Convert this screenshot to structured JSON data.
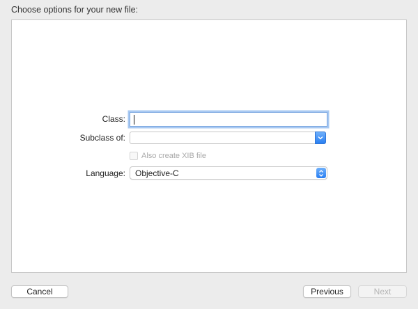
{
  "window": {
    "heading": "Choose options for your new file:"
  },
  "form": {
    "class": {
      "label": "Class:",
      "value": ""
    },
    "subclass": {
      "label": "Subclass of:",
      "value": ""
    },
    "xib": {
      "label": "Also create XIB file",
      "checked": false,
      "enabled": false
    },
    "language": {
      "label": "Language:",
      "value": "Objective-C"
    }
  },
  "buttons": {
    "cancel": "Cancel",
    "previous": "Previous",
    "next": "Next"
  },
  "colors": {
    "accent": "#2a7ff2",
    "focus_ring": "#a9c9f2",
    "window_bg": "#ececec"
  }
}
